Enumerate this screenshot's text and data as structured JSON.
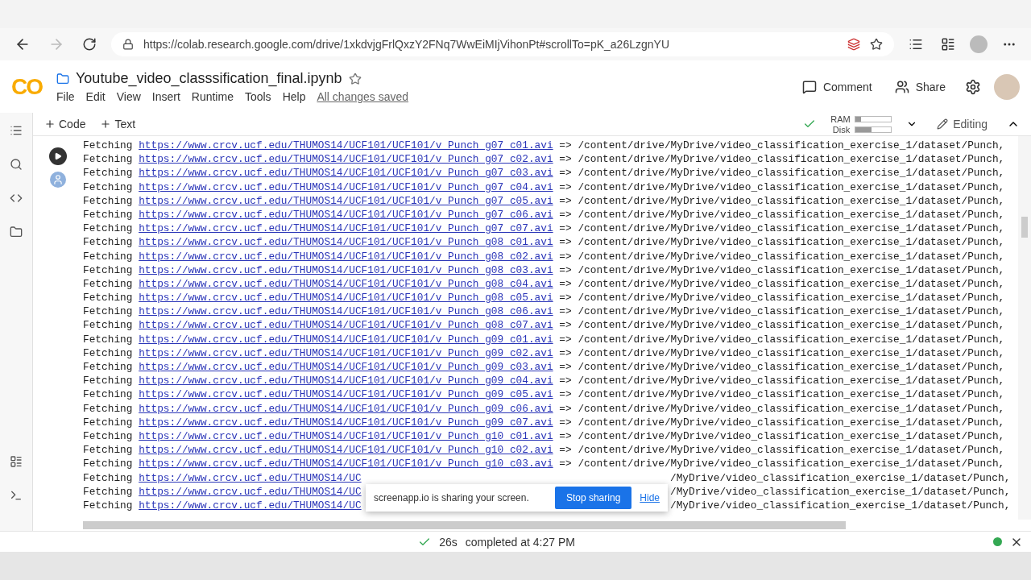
{
  "browser": {
    "url": "https://colab.research.google.com/drive/1xkdvjgFrlQxzY2FNq7WwEiMIjVihonPt#scrollTo=pK_a26LzgnYU"
  },
  "notebook": {
    "logo": "CO",
    "title": "Youtube_video_classsification_final.ipynb",
    "starred": false,
    "menu": [
      "File",
      "Edit",
      "View",
      "Insert",
      "Runtime",
      "Tools",
      "Help"
    ],
    "save_status": "All changes saved",
    "actions": [
      {
        "kind": "comment",
        "label": "Comment"
      },
      {
        "kind": "share",
        "label": "Share"
      }
    ]
  },
  "toolbar": {
    "add_buttons": [
      "Code",
      "Text"
    ],
    "resources": [
      {
        "label": "RAM",
        "level": 0.15
      },
      {
        "label": "Disk",
        "level": 0.45
      }
    ],
    "mode": "Editing"
  },
  "output": {
    "rows": [
      {
        "kind": "full",
        "prefix": "Fetching",
        "url": "https://www.crcv.ucf.edu/THUMOS14/UCF101/UCF101/v_Punch_g07_c01.avi",
        "arrow": "=>",
        "dest": "/content/drive/MyDrive/video_classification_exercise_1/dataset/Punch,"
      },
      {
        "kind": "full",
        "prefix": "Fetching",
        "url": "https://www.crcv.ucf.edu/THUMOS14/UCF101/UCF101/v_Punch_g07_c02.avi",
        "arrow": "=>",
        "dest": "/content/drive/MyDrive/video_classification_exercise_1/dataset/Punch,"
      },
      {
        "kind": "full",
        "prefix": "Fetching",
        "url": "https://www.crcv.ucf.edu/THUMOS14/UCF101/UCF101/v_Punch_g07_c03.avi",
        "arrow": "=>",
        "dest": "/content/drive/MyDrive/video_classification_exercise_1/dataset/Punch,"
      },
      {
        "kind": "full",
        "prefix": "Fetching",
        "url": "https://www.crcv.ucf.edu/THUMOS14/UCF101/UCF101/v_Punch_g07_c04.avi",
        "arrow": "=>",
        "dest": "/content/drive/MyDrive/video_classification_exercise_1/dataset/Punch,"
      },
      {
        "kind": "full",
        "prefix": "Fetching",
        "url": "https://www.crcv.ucf.edu/THUMOS14/UCF101/UCF101/v_Punch_g07_c05.avi",
        "arrow": "=>",
        "dest": "/content/drive/MyDrive/video_classification_exercise_1/dataset/Punch,"
      },
      {
        "kind": "full",
        "prefix": "Fetching",
        "url": "https://www.crcv.ucf.edu/THUMOS14/UCF101/UCF101/v_Punch_g07_c06.avi",
        "arrow": "=>",
        "dest": "/content/drive/MyDrive/video_classification_exercise_1/dataset/Punch,"
      },
      {
        "kind": "full",
        "prefix": "Fetching",
        "url": "https://www.crcv.ucf.edu/THUMOS14/UCF101/UCF101/v_Punch_g07_c07.avi",
        "arrow": "=>",
        "dest": "/content/drive/MyDrive/video_classification_exercise_1/dataset/Punch,"
      },
      {
        "kind": "full",
        "prefix": "Fetching",
        "url": "https://www.crcv.ucf.edu/THUMOS14/UCF101/UCF101/v_Punch_g08_c01.avi",
        "arrow": "=>",
        "dest": "/content/drive/MyDrive/video_classification_exercise_1/dataset/Punch,"
      },
      {
        "kind": "full",
        "prefix": "Fetching",
        "url": "https://www.crcv.ucf.edu/THUMOS14/UCF101/UCF101/v_Punch_g08_c02.avi",
        "arrow": "=>",
        "dest": "/content/drive/MyDrive/video_classification_exercise_1/dataset/Punch,"
      },
      {
        "kind": "full",
        "prefix": "Fetching",
        "url": "https://www.crcv.ucf.edu/THUMOS14/UCF101/UCF101/v_Punch_g08_c03.avi",
        "arrow": "=>",
        "dest": "/content/drive/MyDrive/video_classification_exercise_1/dataset/Punch,"
      },
      {
        "kind": "full",
        "prefix": "Fetching",
        "url": "https://www.crcv.ucf.edu/THUMOS14/UCF101/UCF101/v_Punch_g08_c04.avi",
        "arrow": "=>",
        "dest": "/content/drive/MyDrive/video_classification_exercise_1/dataset/Punch,"
      },
      {
        "kind": "full",
        "prefix": "Fetching",
        "url": "https://www.crcv.ucf.edu/THUMOS14/UCF101/UCF101/v_Punch_g08_c05.avi",
        "arrow": "=>",
        "dest": "/content/drive/MyDrive/video_classification_exercise_1/dataset/Punch,"
      },
      {
        "kind": "full",
        "prefix": "Fetching",
        "url": "https://www.crcv.ucf.edu/THUMOS14/UCF101/UCF101/v_Punch_g08_c06.avi",
        "arrow": "=>",
        "dest": "/content/drive/MyDrive/video_classification_exercise_1/dataset/Punch,"
      },
      {
        "kind": "full",
        "prefix": "Fetching",
        "url": "https://www.crcv.ucf.edu/THUMOS14/UCF101/UCF101/v_Punch_g08_c07.avi",
        "arrow": "=>",
        "dest": "/content/drive/MyDrive/video_classification_exercise_1/dataset/Punch,"
      },
      {
        "kind": "full",
        "prefix": "Fetching",
        "url": "https://www.crcv.ucf.edu/THUMOS14/UCF101/UCF101/v_Punch_g09_c01.avi",
        "arrow": "=>",
        "dest": "/content/drive/MyDrive/video_classification_exercise_1/dataset/Punch,"
      },
      {
        "kind": "full",
        "prefix": "Fetching",
        "url": "https://www.crcv.ucf.edu/THUMOS14/UCF101/UCF101/v_Punch_g09_c02.avi",
        "arrow": "=>",
        "dest": "/content/drive/MyDrive/video_classification_exercise_1/dataset/Punch,"
      },
      {
        "kind": "full",
        "prefix": "Fetching",
        "url": "https://www.crcv.ucf.edu/THUMOS14/UCF101/UCF101/v_Punch_g09_c03.avi",
        "arrow": "=>",
        "dest": "/content/drive/MyDrive/video_classification_exercise_1/dataset/Punch,"
      },
      {
        "kind": "full",
        "prefix": "Fetching",
        "url": "https://www.crcv.ucf.edu/THUMOS14/UCF101/UCF101/v_Punch_g09_c04.avi",
        "arrow": "=>",
        "dest": "/content/drive/MyDrive/video_classification_exercise_1/dataset/Punch,"
      },
      {
        "kind": "full",
        "prefix": "Fetching",
        "url": "https://www.crcv.ucf.edu/THUMOS14/UCF101/UCF101/v_Punch_g09_c05.avi",
        "arrow": "=>",
        "dest": "/content/drive/MyDrive/video_classification_exercise_1/dataset/Punch,"
      },
      {
        "kind": "full",
        "prefix": "Fetching",
        "url": "https://www.crcv.ucf.edu/THUMOS14/UCF101/UCF101/v_Punch_g09_c06.avi",
        "arrow": "=>",
        "dest": "/content/drive/MyDrive/video_classification_exercise_1/dataset/Punch,"
      },
      {
        "kind": "full",
        "prefix": "Fetching",
        "url": "https://www.crcv.ucf.edu/THUMOS14/UCF101/UCF101/v_Punch_g09_c07.avi",
        "arrow": "=>",
        "dest": "/content/drive/MyDrive/video_classification_exercise_1/dataset/Punch,"
      },
      {
        "kind": "full",
        "prefix": "Fetching",
        "url": "https://www.crcv.ucf.edu/THUMOS14/UCF101/UCF101/v_Punch_g10_c01.avi",
        "arrow": "=>",
        "dest": "/content/drive/MyDrive/video_classification_exercise_1/dataset/Punch,"
      },
      {
        "kind": "full",
        "prefix": "Fetching",
        "url": "https://www.crcv.ucf.edu/THUMOS14/UCF101/UCF101/v_Punch_g10_c02.avi",
        "arrow": "=>",
        "dest": "/content/drive/MyDrive/video_classification_exercise_1/dataset/Punch,"
      },
      {
        "kind": "full",
        "prefix": "Fetching",
        "url": "https://www.crcv.ucf.edu/THUMOS14/UCF101/UCF101/v_Punch_g10_c03.avi",
        "arrow": "=>",
        "dest": "/content/drive/MyDrive/video_classification_exercise_1/dataset/Punch,"
      },
      {
        "kind": "covered",
        "prefix": "Fetching",
        "url": "https://www.crcv.ucf.edu/THUMOS14/UC",
        "dest": "/MyDrive/video_classification_exercise_1/dataset/Punch,"
      },
      {
        "kind": "covered",
        "prefix": "Fetching",
        "url": "https://www.crcv.ucf.edu/THUMOS14/UC",
        "dest": "/MyDrive/video_classification_exercise_1/dataset/Punch,"
      },
      {
        "kind": "covered",
        "prefix": "Fetching",
        "url": "https://www.crcv.ucf.edu/THUMOS14/UC",
        "dest": "/MyDrive/video_classification_exercise_1/dataset/Punch,"
      }
    ]
  },
  "toast": {
    "message": "screenapp.io is sharing your screen.",
    "stop": "Stop sharing",
    "hide": "Hide"
  },
  "status": {
    "duration": "26s",
    "message": "completed at 4:27 PM",
    "connected": true
  }
}
